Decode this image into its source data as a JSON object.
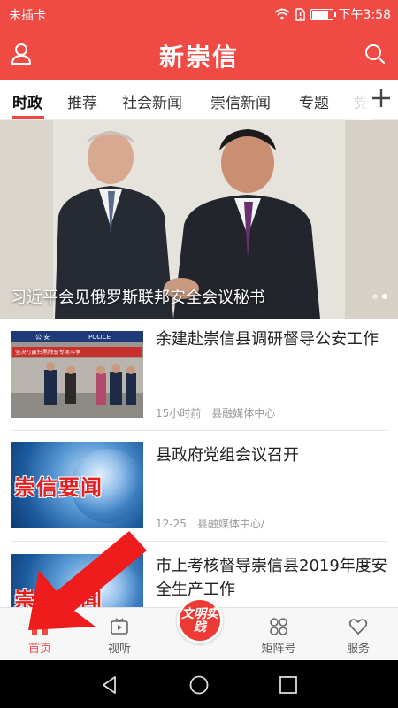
{
  "status_bar": {
    "carrier": "未插卡",
    "time": "下午3:58",
    "battery_level": 0.85,
    "icons": [
      "wifi-icon",
      "sim-alert-icon",
      "battery-icon"
    ]
  },
  "header": {
    "title": "新崇信",
    "left_icon": "user-icon",
    "right_icon": "search-icon",
    "brand_color": "#ef4a43"
  },
  "tabs": {
    "items": [
      "时政",
      "推荐",
      "社会新闻",
      "崇信新闻",
      "专题",
      "党"
    ],
    "active": "时政",
    "add_icon": "plus-icon"
  },
  "banner": {
    "caption": "习近平会见俄罗斯联邦安全会议秘书",
    "slide_count": 2,
    "active_slide": 1
  },
  "news": [
    {
      "headline": "余建赴崇信县调研督导公安工作",
      "time": "15小时前",
      "source": "县融媒体中心",
      "thumb": {
        "sign_text": "POLICE",
        "sign_prefix": "公 安",
        "banner_text": "坚决打赢扫黑除恶专项斗争"
      }
    },
    {
      "headline": "县政府党组会议召开",
      "time": "12-25",
      "source": "县融媒体中心/",
      "thumb": {
        "brand_text": "崇信要闻"
      }
    },
    {
      "headline": "市上考核督导崇信县2019年度安全生产工作",
      "thumb": {
        "brand_text": "崇信要闻"
      }
    }
  ],
  "bottom_nav": {
    "items": [
      {
        "label": "首页",
        "icon": "home-icon"
      },
      {
        "label": "视听",
        "icon": "tv-icon"
      },
      {
        "label": "",
        "icon": "wenming-logo",
        "logo_text": "文明实践"
      },
      {
        "label": "矩阵号",
        "icon": "matrix-icon"
      },
      {
        "label": "服务",
        "icon": "heart-icon"
      }
    ],
    "active": "首页"
  },
  "system_nav": {
    "icons": [
      "back-icon",
      "home-circle-icon",
      "recents-icon"
    ]
  }
}
